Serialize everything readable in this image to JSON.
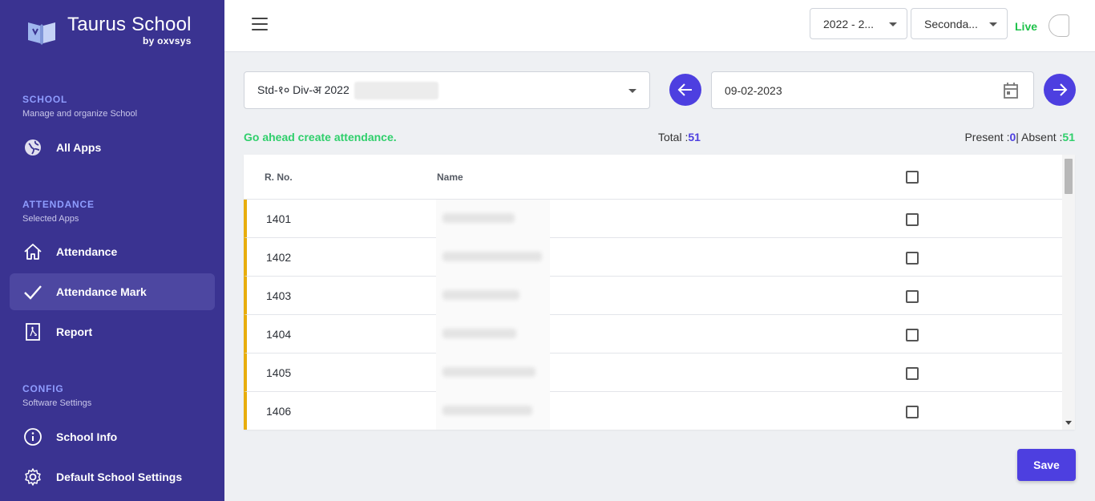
{
  "brand": {
    "title": "Taurus School",
    "subtitle": "by oxvsys"
  },
  "sidebar": {
    "sections": [
      {
        "title": "SCHOOL",
        "subtitle": "Manage and organize School",
        "items": [
          {
            "label": "All Apps",
            "icon": "globe-icon"
          }
        ]
      },
      {
        "title": "ATTENDANCE",
        "subtitle": "Selected Apps",
        "items": [
          {
            "label": "Attendance",
            "icon": "home-icon"
          },
          {
            "label": "Attendance Mark",
            "icon": "check-icon",
            "active": true
          },
          {
            "label": "Report",
            "icon": "pdf-icon"
          }
        ]
      },
      {
        "title": "CONFIG",
        "subtitle": "Software Settings",
        "items": [
          {
            "label": "School Info",
            "icon": "info-icon"
          },
          {
            "label": "Default School Settings",
            "icon": "gear-icon"
          }
        ]
      }
    ]
  },
  "header": {
    "year_select": "2022 - 2...",
    "section_select": "Seconda...",
    "live_label": "Live"
  },
  "controls": {
    "class_select": "Std-१० Div-अ 2022",
    "date": "09-02-2023"
  },
  "summary": {
    "message": "Go ahead create attendance.",
    "total_label": "Total :",
    "total_value": "51",
    "present_label": "Present :",
    "present_value": "0",
    "separator": "|",
    "absent_label": "Absent :",
    "absent_value": "51"
  },
  "table": {
    "columns": [
      "R. No.",
      "Name"
    ],
    "rows": [
      {
        "rno": "1401"
      },
      {
        "rno": "1402"
      },
      {
        "rno": "1403"
      },
      {
        "rno": "1404"
      },
      {
        "rno": "1405"
      },
      {
        "rno": "1406"
      }
    ]
  },
  "actions": {
    "save_label": "Save"
  },
  "colors": {
    "sidebar_bg": "#3a3391",
    "accent": "#4d3fe0",
    "green": "#2fcf6b",
    "row_marker": "#e8ad0c"
  }
}
